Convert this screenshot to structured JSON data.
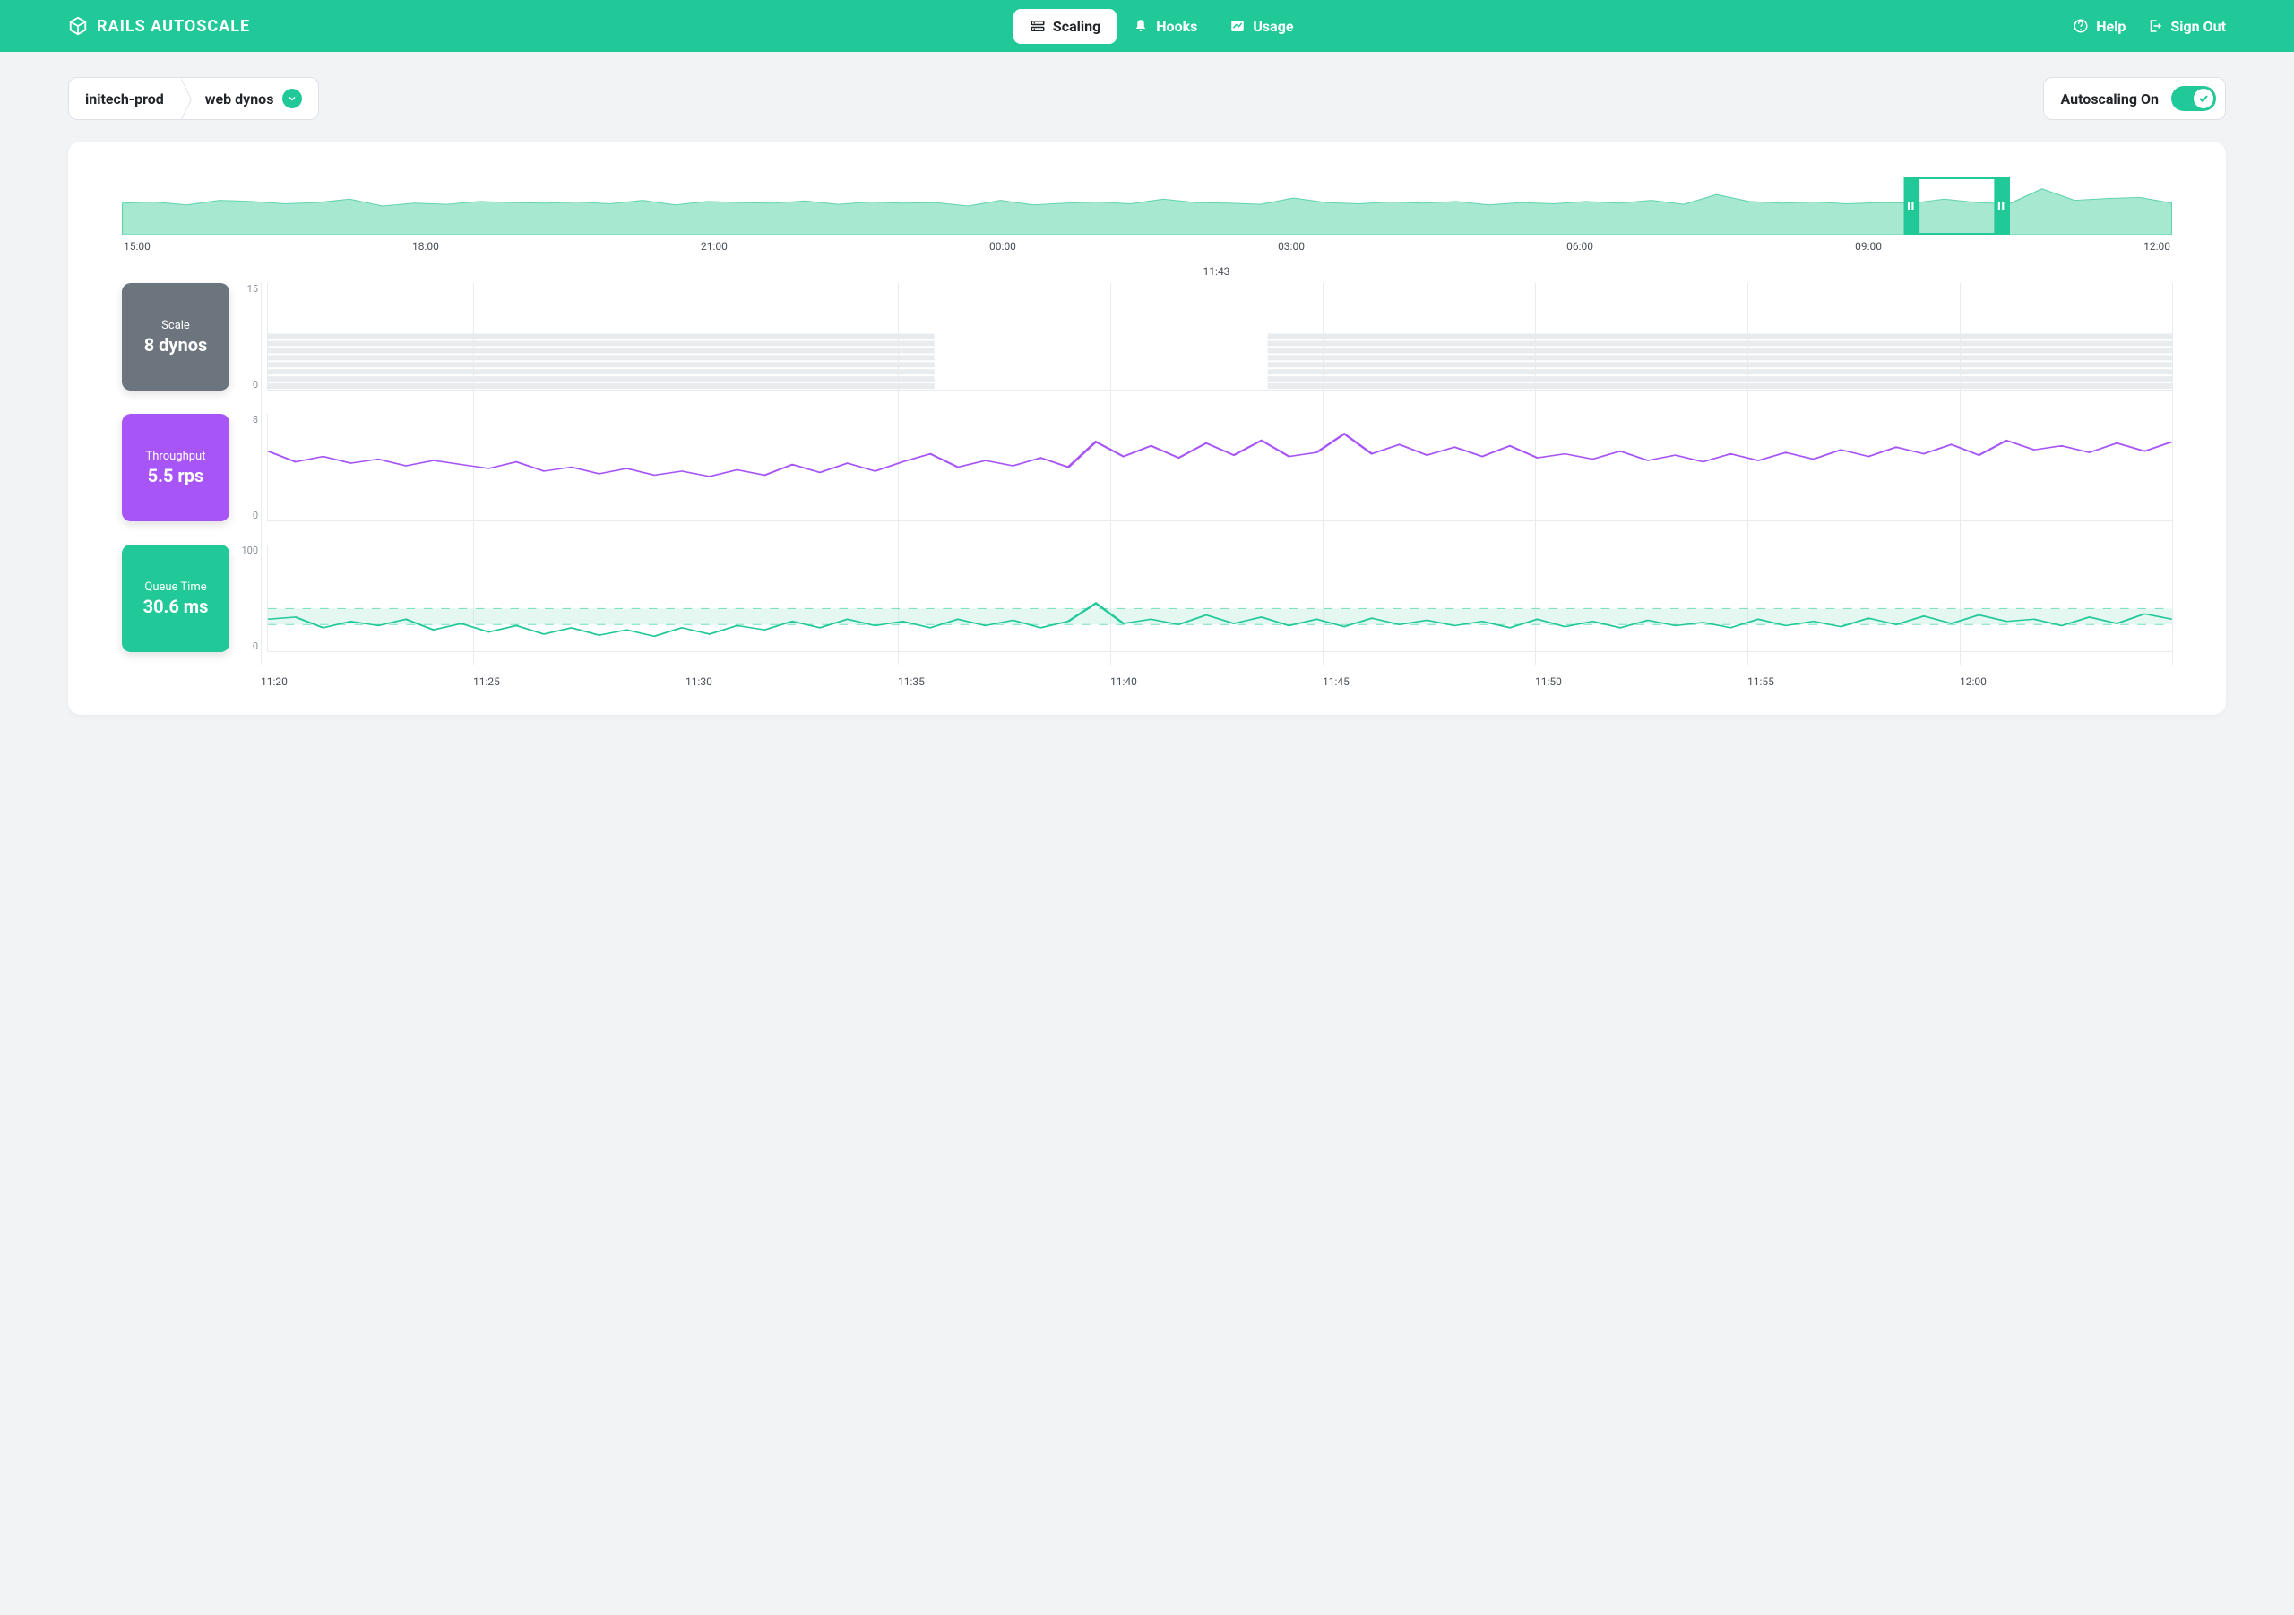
{
  "brand": "RAILS AUTOSCALE",
  "nav": {
    "scaling": "Scaling",
    "hooks": "Hooks",
    "usage": "Usage",
    "help": "Help",
    "signout": "Sign Out"
  },
  "breadcrumb": {
    "app": "initech-prod",
    "process": "web dynos"
  },
  "autoscaling": {
    "label": "Autoscaling On"
  },
  "hover_time": "11:43",
  "overview_ticks": [
    "15:00",
    "18:00",
    "21:00",
    "00:00",
    "03:00",
    "06:00",
    "09:00",
    "12:00"
  ],
  "xaxis_ticks": [
    "11:20",
    "11:25",
    "11:30",
    "11:35",
    "11:40",
    "11:45",
    "11:50",
    "11:55",
    "12:00"
  ],
  "cards": {
    "scale": {
      "label": "Scale",
      "value": "8 dynos",
      "ymax": "15",
      "ymin": "0"
    },
    "throughput": {
      "label": "Throughput",
      "value": "5.5 rps",
      "ymax": "8",
      "ymin": "0"
    },
    "queue": {
      "label": "Queue Time",
      "value": "30.6 ms",
      "ymax": "100",
      "ymin": "0"
    }
  },
  "chart_data": [
    {
      "type": "area",
      "title": "Overview sparkline (24h)",
      "xlabel": "",
      "ylabel": "",
      "x_ticks": [
        "15:00",
        "18:00",
        "21:00",
        "00:00",
        "03:00",
        "06:00",
        "09:00",
        "12:00"
      ],
      "ylim": [
        0,
        1
      ],
      "values": [
        0.55,
        0.57,
        0.52,
        0.6,
        0.58,
        0.54,
        0.56,
        0.62,
        0.5,
        0.55,
        0.53,
        0.58,
        0.56,
        0.55,
        0.57,
        0.54,
        0.6,
        0.52,
        0.58,
        0.56,
        0.55,
        0.59,
        0.53,
        0.57,
        0.55,
        0.56,
        0.5,
        0.6,
        0.52,
        0.55,
        0.57,
        0.54,
        0.62,
        0.56,
        0.55,
        0.53,
        0.64,
        0.56,
        0.54,
        0.57,
        0.55,
        0.58,
        0.52,
        0.56,
        0.54,
        0.58,
        0.55,
        0.6,
        0.53,
        0.7,
        0.58,
        0.55,
        0.57,
        0.54,
        0.56,
        0.55,
        0.62,
        0.56,
        0.54,
        0.8,
        0.6,
        0.63,
        0.65,
        0.55
      ],
      "brush_window": [
        0.872,
        0.918
      ]
    },
    {
      "type": "bar",
      "title": "Scale",
      "ylabel": "dynos",
      "ylim": [
        0,
        15
      ],
      "x": [
        "11:20",
        "11:25",
        "11:30",
        "11:35",
        "11:40",
        "11:45",
        "11:50",
        "11:55",
        "12:00"
      ],
      "values_at_cursor": 8,
      "segments": [
        {
          "start": "11:20",
          "end": "11:34",
          "dynos": 8
        },
        {
          "start": "11:34",
          "end": "11:41",
          "dynos": 0
        },
        {
          "start": "11:41",
          "end": "12:05",
          "dynos": 8
        }
      ]
    },
    {
      "type": "line",
      "title": "Throughput",
      "ylabel": "rps",
      "ylim": [
        0,
        8
      ],
      "x_ticks": [
        "11:20",
        "11:25",
        "11:30",
        "11:35",
        "11:40",
        "11:45",
        "11:50",
        "11:55",
        "12:00"
      ],
      "value_at_cursor": 5.5,
      "values": [
        5.2,
        4.4,
        4.8,
        4.3,
        4.6,
        4.1,
        4.5,
        4.2,
        3.9,
        4.4,
        3.7,
        4.0,
        3.5,
        3.9,
        3.4,
        3.7,
        3.3,
        3.8,
        3.4,
        4.2,
        3.6,
        4.3,
        3.7,
        4.4,
        5.0,
        4.0,
        4.5,
        4.1,
        4.7,
        4.0,
        5.9,
        4.8,
        5.6,
        4.7,
        5.8,
        4.9,
        6.0,
        4.8,
        5.1,
        6.5,
        5.0,
        5.7,
        4.9,
        5.5,
        4.8,
        5.6,
        4.7,
        5.0,
        4.6,
        5.2,
        4.5,
        4.9,
        4.4,
        5.0,
        4.5,
        5.1,
        4.6,
        5.3,
        4.8,
        5.5,
        5.0,
        5.7,
        4.9,
        6.0,
        5.3,
        5.6,
        5.1,
        5.8,
        5.2,
        5.9
      ]
    },
    {
      "type": "line",
      "title": "Queue Time",
      "ylabel": "ms",
      "ylim": [
        0,
        100
      ],
      "x_ticks": [
        "11:20",
        "11:25",
        "11:30",
        "11:35",
        "11:40",
        "11:45",
        "11:50",
        "11:55",
        "12:00"
      ],
      "threshold_band": [
        25,
        40
      ],
      "value_at_cursor": 30.6,
      "values": [
        30,
        32,
        22,
        28,
        24,
        30,
        20,
        26,
        18,
        24,
        16,
        22,
        15,
        20,
        14,
        22,
        16,
        24,
        20,
        28,
        22,
        30,
        24,
        28,
        22,
        30,
        24,
        29,
        22,
        28,
        45,
        26,
        30,
        25,
        34,
        26,
        32,
        24,
        30,
        23,
        31,
        25,
        29,
        24,
        28,
        22,
        30,
        23,
        28,
        22,
        29,
        24,
        27,
        22,
        30,
        24,
        28,
        23,
        31,
        25,
        33,
        26,
        34,
        28,
        30,
        24,
        32,
        26,
        35,
        30
      ]
    }
  ]
}
